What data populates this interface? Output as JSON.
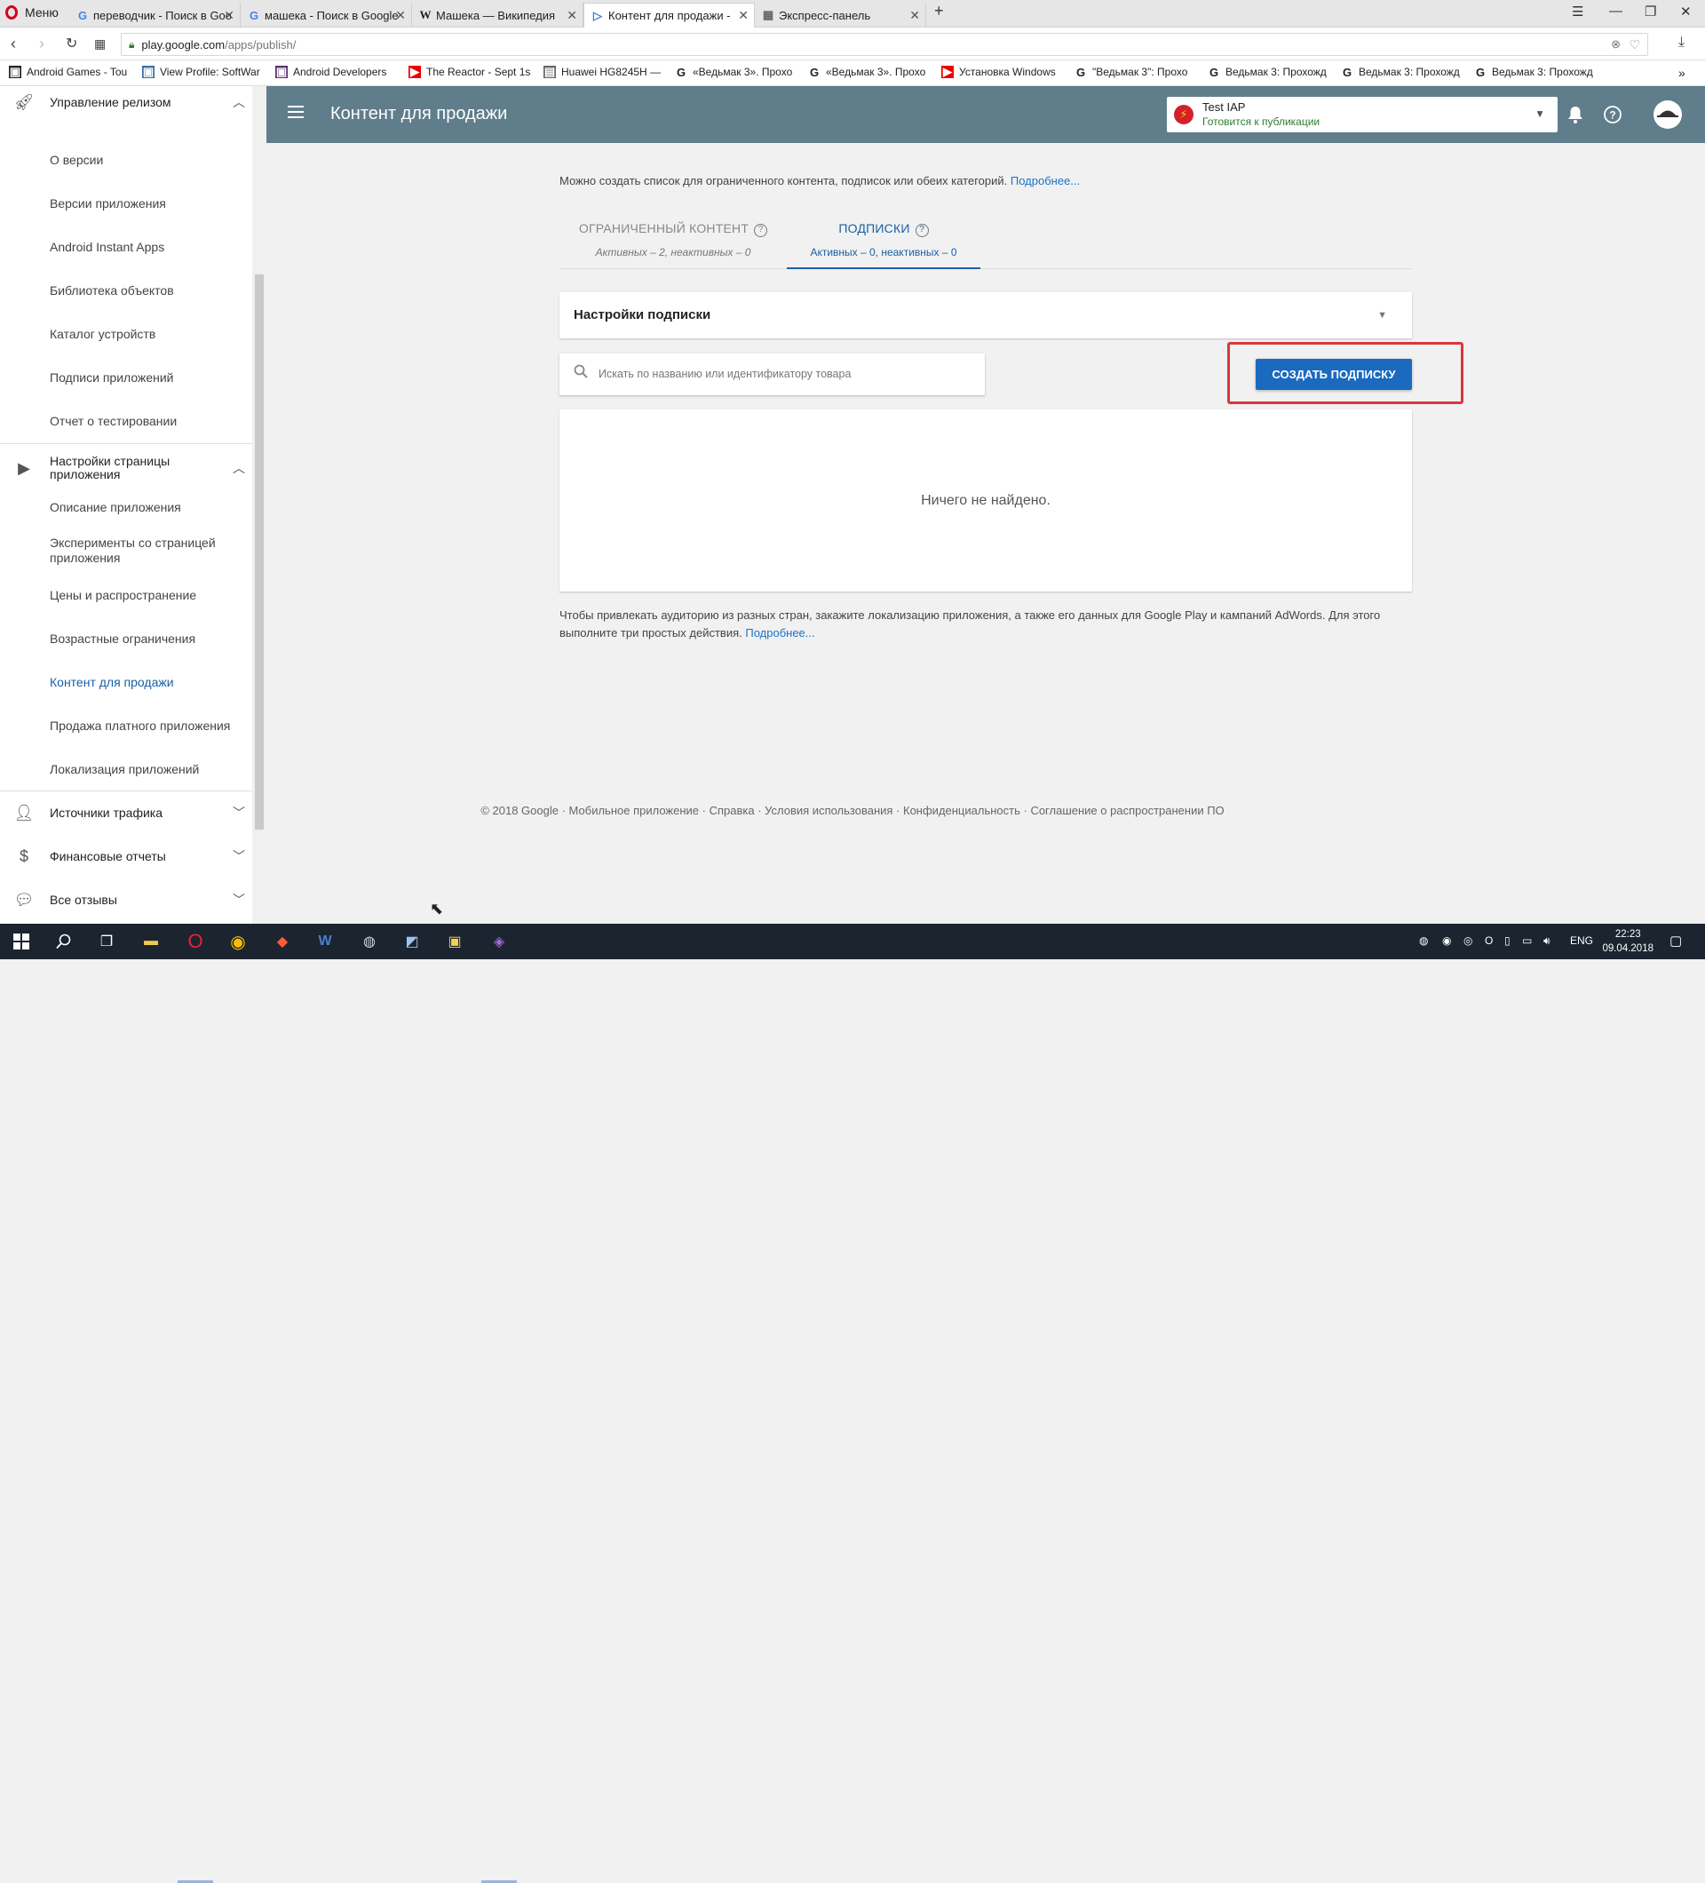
{
  "browser": {
    "menu_label": "Меню",
    "tabs": [
      {
        "label": "переводчик - Поиск в Google",
        "icon": "google-g-icon"
      },
      {
        "label": "машека - Поиск в Google",
        "icon": "google-g-icon"
      },
      {
        "label": "Машека — Википедия",
        "icon": "wikipedia-w-icon"
      },
      {
        "label": "Контент для продажи - Test IAP",
        "icon": "play-console-icon"
      },
      {
        "label": "Экспресс-панель",
        "icon": "speed-dial-icon"
      }
    ],
    "url_host": "play.google.com",
    "url_path": "/apps/publish/",
    "bookmarks": [
      "Android Games - Tou",
      "View Profile: SoftWar",
      "Android Developers",
      "The Reactor - Sept 1s",
      "Huawei HG8245H —",
      "«Ведьмак 3». Прохо",
      "«Ведьмак 3». Прохо",
      "Установка Windows",
      "\"Ведьмак 3\": Прохо",
      "Ведьмак 3: Прохожд",
      "Ведьмак 3: Прохожд",
      "Ведьмак 3: Прохожд"
    ]
  },
  "sidebar": {
    "release_section": "Управление релизом",
    "release_items": [
      "О версии",
      "Версии приложения",
      "Android Instant Apps",
      "Библиотека объектов",
      "Каталог устройств",
      "Подписи приложений",
      "Отчет о тестировании"
    ],
    "store_section": "Настройки страницы приложения",
    "store_items": [
      "Описание приложения",
      "Эксперименты со страницей приложения",
      "Цены и распространение",
      "Возрастные ограничения",
      "Контент для продажи",
      "Продажа платного приложения",
      "Локализация приложений"
    ],
    "bottom_sections": [
      "Источники трафика",
      "Финансовые отчеты",
      "Все отзывы"
    ]
  },
  "header": {
    "title": "Контент для продажи",
    "app_name": "Test IAP",
    "app_status": "Готовится к публикации"
  },
  "content": {
    "intro_text": "Можно создать список для ограниченного контента, подписок или обеих категорий.",
    "intro_link": "Подробнее...",
    "tab_managed": {
      "label": "ОГРАНИЧЕННЫЙ КОНТЕНТ",
      "sub": "Активных – 2, неактивных – 0"
    },
    "tab_subs": {
      "label": "ПОДПИСКИ",
      "sub": "Активных – 0, неактивных – 0"
    },
    "settings_title": "Настройки подписки",
    "search_placeholder": "Искать по названию или идентификатору товара",
    "create_button": "СОЗДАТЬ ПОДПИСКУ",
    "empty_text": "Ничего не найдено.",
    "note_text": "Чтобы привлекать аудиторию из разных стран, закажите локализацию приложения, а также его данных для Google Play и кампаний AdWords. Для этого выполните три простых действия.",
    "note_link": "Подробнее..."
  },
  "footer": {
    "items": [
      "© 2018 Google",
      "Мобильное приложение",
      "Справка",
      "Условия использования",
      "Конфиденциальность",
      "Соглашение о распространении ПО"
    ]
  },
  "taskbar": {
    "lang": "ENG",
    "time": "22:23",
    "date": "09.04.2018"
  },
  "colors": {
    "header_bg": "#607d8b",
    "accent": "#1a5fa8",
    "button": "#1b6ac0",
    "highlight": "#d9383b",
    "status_green": "#2e7d32"
  }
}
